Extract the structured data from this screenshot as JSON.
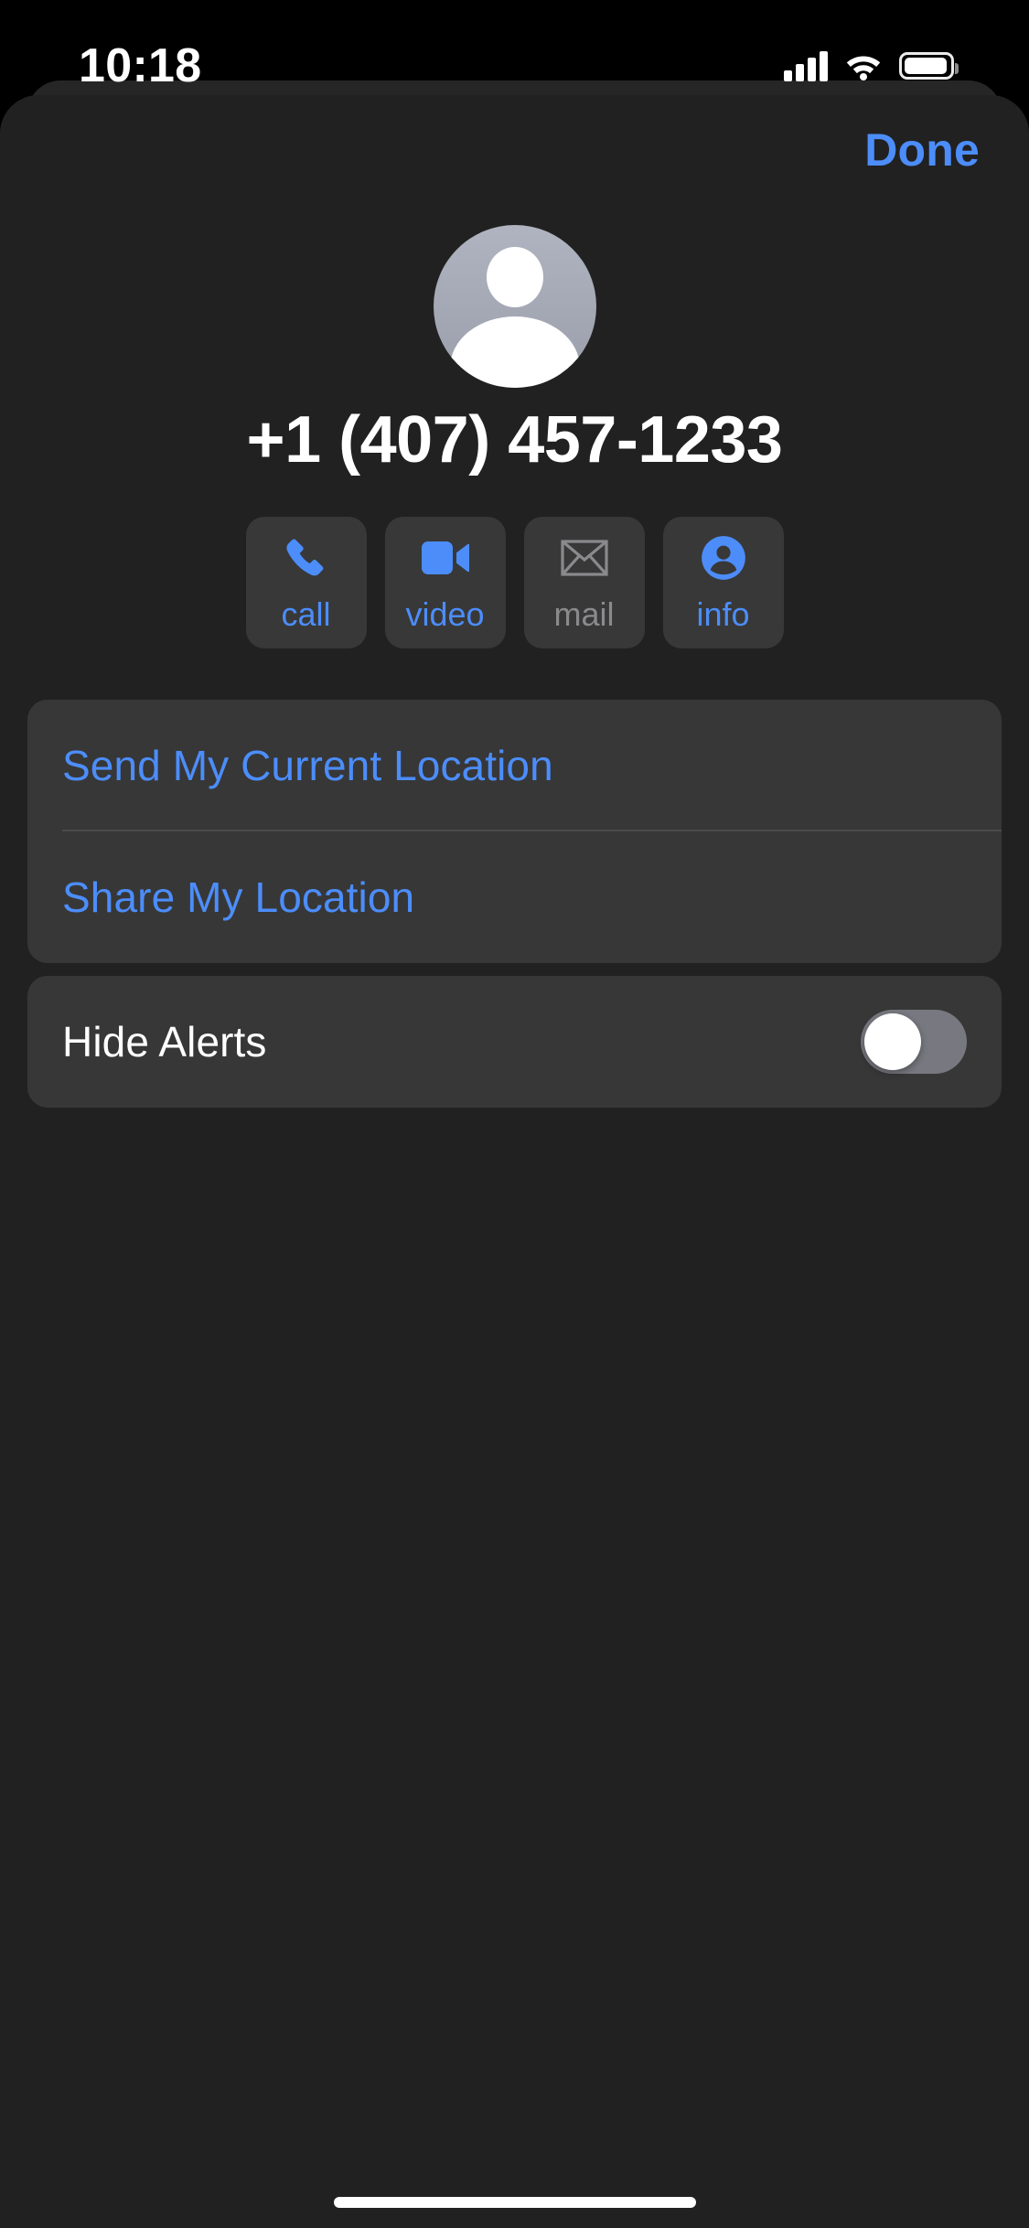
{
  "status_bar": {
    "time": "10:18",
    "signal_icon": "cellular-bars-icon",
    "wifi_icon": "wifi-icon",
    "battery_icon": "battery-full-icon"
  },
  "sheet": {
    "done_label": "Done",
    "avatar_icon": "default-contact-avatar-icon",
    "contact_number": "+1 (407) 457-1233"
  },
  "actions": [
    {
      "label": "call",
      "icon": "phone-icon",
      "enabled": true
    },
    {
      "label": "video",
      "icon": "video-camera-icon",
      "enabled": true
    },
    {
      "label": "mail",
      "icon": "envelope-icon",
      "enabled": false
    },
    {
      "label": "info",
      "icon": "person-circle-icon",
      "enabled": true
    }
  ],
  "location_group": {
    "rows": [
      {
        "label": "Send My Current Location"
      },
      {
        "label": "Share My Location"
      }
    ]
  },
  "alerts_group": {
    "row_label": "Hide Alerts",
    "toggle_state": "off"
  },
  "colors": {
    "accent_blue": "#4c8dfa",
    "disabled_gray": "#8a8a8d",
    "sheet_bg": "#212121",
    "card_bg": "#373737",
    "button_bg": "#383838",
    "toggle_off": "#787880",
    "avatar_gray": "#a4a8b4"
  },
  "home_indicator": "home-indicator"
}
